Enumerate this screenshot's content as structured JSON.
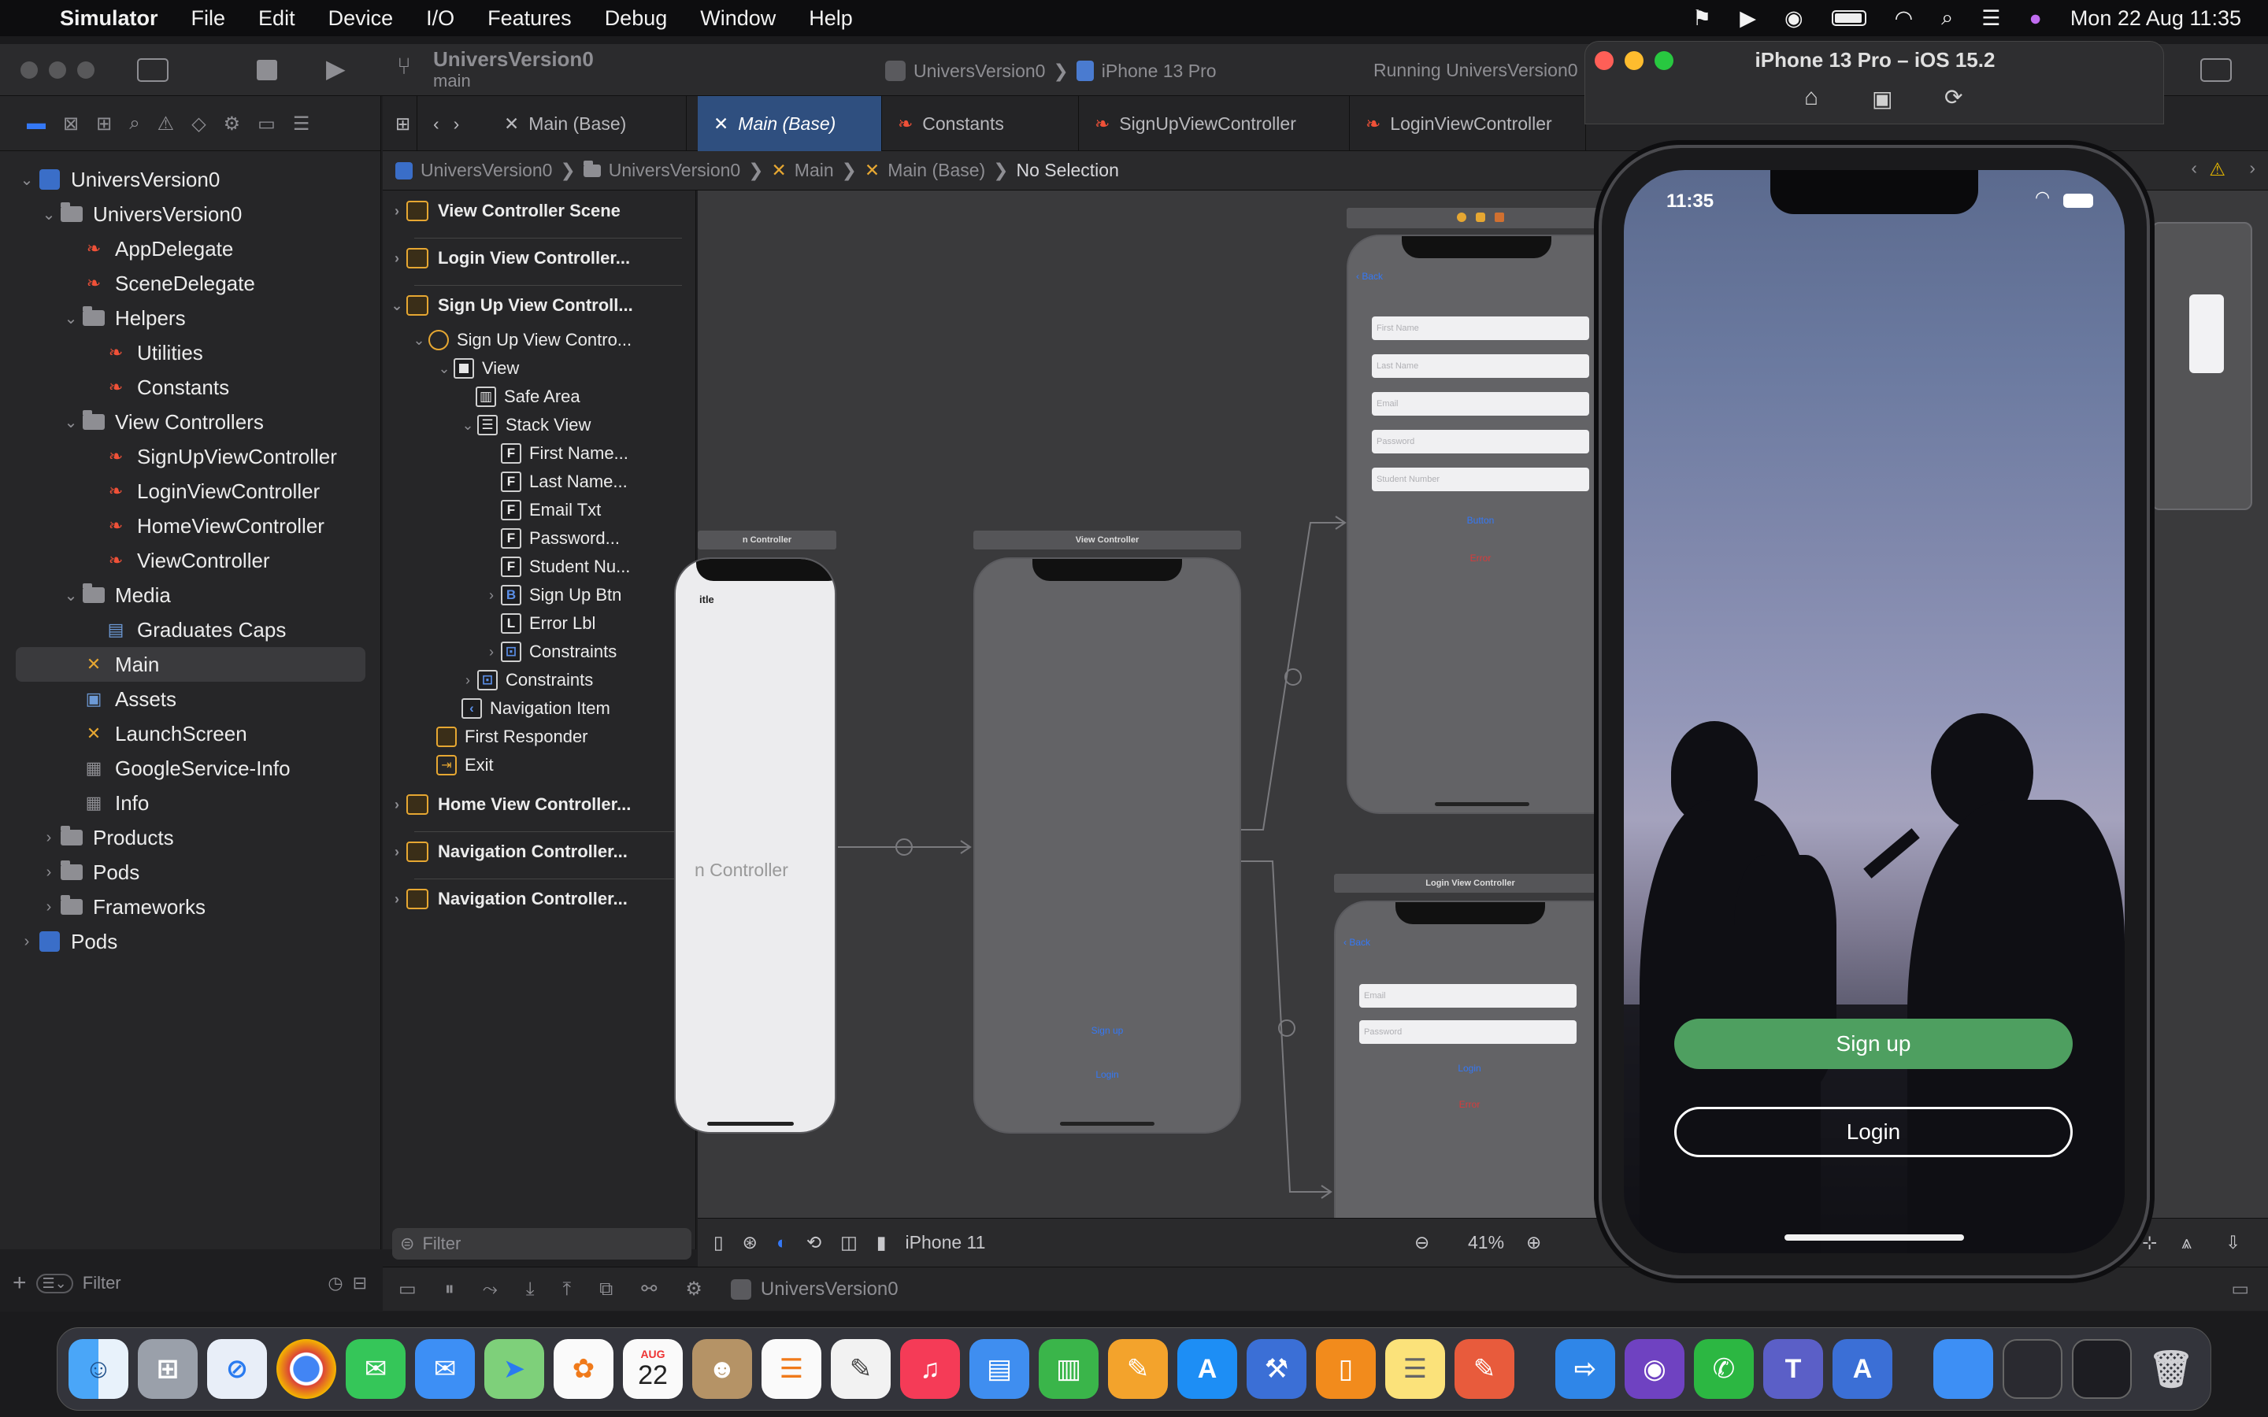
{
  "menubar": {
    "app": "Simulator",
    "items": [
      "File",
      "Edit",
      "Device",
      "I/O",
      "Features",
      "Debug",
      "Window",
      "Help"
    ],
    "clock": "Mon 22 Aug  11:35"
  },
  "toolbar": {
    "project": "UniversVersion0",
    "branch": "main",
    "scheme": "UniversVersion0",
    "device": "iPhone 13 Pro",
    "status": "Running UniversVersion0"
  },
  "editor_tabs": [
    "Main (Base)",
    "Main (Base)",
    "Constants",
    "SignUpViewController",
    "LoginViewController"
  ],
  "jumpbar": [
    "UniversVersion0",
    "UniversVersion0",
    "Main",
    "Main (Base)",
    "No Selection"
  ],
  "navigator": {
    "items": [
      {
        "label": "UniversVersion0",
        "icon": "project-icon"
      },
      {
        "label": "UniversVersion0",
        "icon": "folder-icon"
      },
      {
        "label": "AppDelegate",
        "icon": "swift-icon"
      },
      {
        "label": "SceneDelegate",
        "icon": "swift-icon"
      },
      {
        "label": "Helpers",
        "icon": "folder-icon"
      },
      {
        "label": "Utilities",
        "icon": "swift-icon"
      },
      {
        "label": "Constants",
        "icon": "swift-icon"
      },
      {
        "label": "View Controllers",
        "icon": "folder-icon"
      },
      {
        "label": "SignUpViewController",
        "icon": "swift-icon"
      },
      {
        "label": "LoginViewController",
        "icon": "swift-icon"
      },
      {
        "label": "HomeViewController",
        "icon": "swift-icon"
      },
      {
        "label": "ViewController",
        "icon": "swift-icon"
      },
      {
        "label": "Media",
        "icon": "folder-icon"
      },
      {
        "label": "Graduates Caps",
        "icon": "video-icon"
      },
      {
        "label": "Main",
        "icon": "storyboard-icon"
      },
      {
        "label": "Assets",
        "icon": "assets-icon"
      },
      {
        "label": "LaunchScreen",
        "icon": "storyboard-icon"
      },
      {
        "label": "GoogleService-Info",
        "icon": "plist-icon"
      },
      {
        "label": "Info",
        "icon": "plist-icon"
      },
      {
        "label": "Products",
        "icon": "folder-icon"
      },
      {
        "label": "Pods",
        "icon": "folder-icon"
      },
      {
        "label": "Frameworks",
        "icon": "folder-icon"
      },
      {
        "label": "Pods",
        "icon": "project-icon"
      }
    ],
    "filter_placeholder": "Filter"
  },
  "outline": {
    "items": [
      "View Controller Scene",
      "Login View Controller...",
      "Sign Up View Controll...",
      "Sign Up View Contro...",
      "View",
      "Safe Area",
      "Stack View",
      "First Name...",
      "Last Name...",
      "Email Txt",
      "Password...",
      "Student Nu...",
      "Sign Up Btn",
      "Error Lbl",
      "Constraints",
      "Constraints",
      "Navigation Item",
      "First Responder",
      "Exit",
      "Home View Controller...",
      "Navigation Controller...",
      "Navigation Controller..."
    ],
    "filter_placeholder": "Filter"
  },
  "canvas": {
    "scene_left_header": "n Controller",
    "scene_left_title": "itle",
    "scene_left_body": "n Controller",
    "scene_mid_header": "View Controller",
    "scene_mid_signup": "Sign up",
    "scene_mid_login": "Login",
    "signup_back": "Back",
    "signup_fields": [
      "First Name",
      "Last Name",
      "Email",
      "Password",
      "Student Number"
    ],
    "signup_button": "Button",
    "signup_error": "Error",
    "login_header": "Login View Controller",
    "login_back": "Back",
    "login_fields": [
      "Email",
      "Password"
    ],
    "login_button": "Login",
    "login_error": "Error"
  },
  "bottombar": {
    "device": "iPhone 11",
    "zoom": "41%"
  },
  "debugbar": {
    "scheme": "UniversVersion0"
  },
  "simulator": {
    "title": "iPhone 13 Pro – iOS 15.2",
    "time": "11:35",
    "signup_label": "Sign up",
    "login_label": "Login"
  },
  "dock": {
    "calendar_month": "AUG",
    "calendar_day": "22",
    "apps": [
      "finder",
      "launchpad",
      "safari",
      "chrome",
      "messages",
      "mail",
      "maps",
      "photos",
      "calendar",
      "contacts",
      "reminders",
      "textedit",
      "music",
      "keynote",
      "numbers",
      "pages",
      "app-store",
      "xcode",
      "books",
      "notes",
      "sketch",
      "transmit",
      "github",
      "whatsapp",
      "teams",
      "xcode-instruments",
      "folder",
      "screenshots",
      "stacks",
      "trash"
    ]
  },
  "colors": {
    "accent": "#3478f6",
    "signup_green": "#4e9f60",
    "error_red": "#d83b3b"
  }
}
